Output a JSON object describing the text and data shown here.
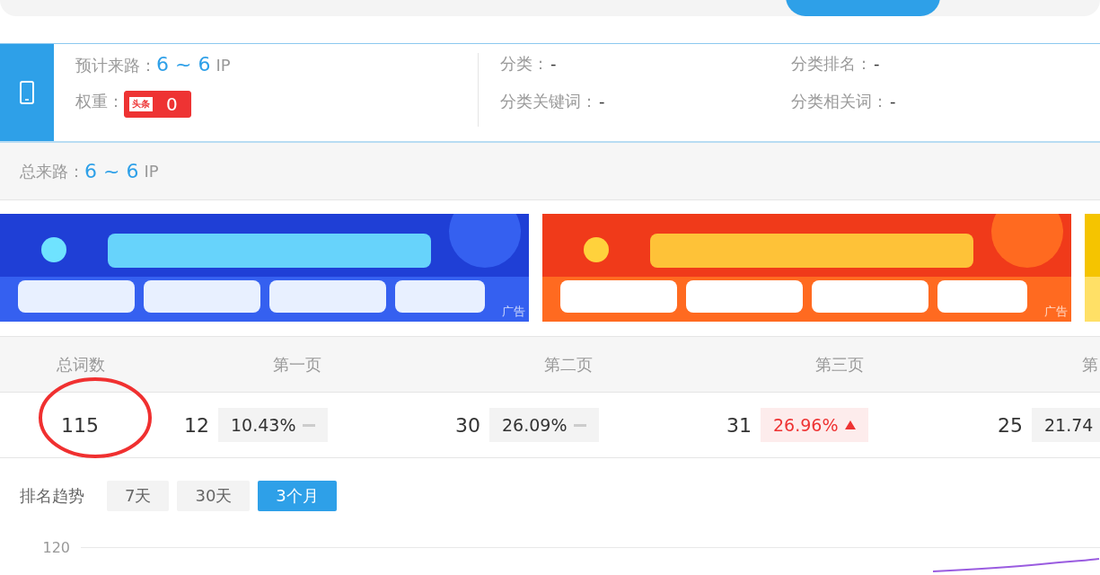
{
  "mobile_info": {
    "estimated_traffic_label": "预计来路：",
    "estimated_traffic_value": "6 ~ 6",
    "estimated_traffic_unit": "IP",
    "weight_label": "权重：",
    "weight_badge_logo": "头条",
    "weight_value": "0",
    "category_label": "分类：",
    "category_value": "-",
    "category_rank_label": "分类排名：",
    "category_rank_value": "-",
    "category_keywords_label": "分类关键词：",
    "category_keywords_value": "-",
    "category_related_label": "分类相关词：",
    "category_related_value": "-"
  },
  "total_traffic": {
    "label": "总来路：",
    "value": "6 ~ 6",
    "unit": "IP"
  },
  "ads": [
    {
      "kind": "picture",
      "label": "广告"
    },
    {
      "kind": "picture",
      "label": "广告"
    },
    {
      "kind": "picture"
    }
  ],
  "rank_stats": {
    "total": {
      "header": "总词数",
      "value": "115"
    },
    "pages": [
      {
        "header": "第一页",
        "count": "12",
        "percent": "10.43%",
        "kind": "flat"
      },
      {
        "header": "第二页",
        "count": "30",
        "percent": "26.09%",
        "kind": "flat"
      },
      {
        "header": "第三页",
        "count": "31",
        "percent": "26.96%",
        "kind": "up"
      },
      {
        "header": "第",
        "count": "25",
        "percent": "21.74"
      }
    ]
  },
  "annotation": {
    "kind": "ellipse"
  },
  "trend": {
    "title": "排名趋势",
    "ranges": [
      {
        "label": "7天",
        "selected": false
      },
      {
        "label": "30天",
        "selected": false
      },
      {
        "label": "3个月",
        "selected": true
      }
    ],
    "y_tick": "120"
  }
}
